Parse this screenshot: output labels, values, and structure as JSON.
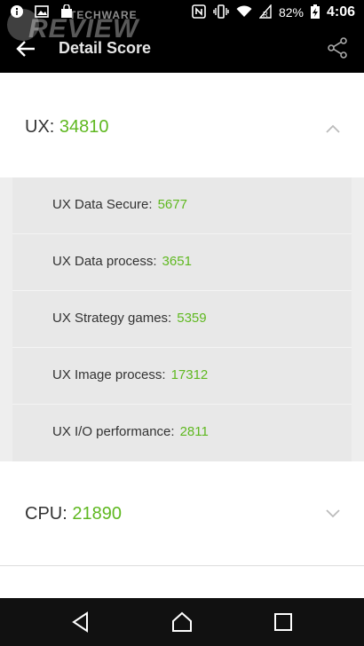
{
  "status_bar": {
    "battery": "82%",
    "time": "4:06"
  },
  "watermark": {
    "small": "TECHWARE",
    "big": "REVIEW"
  },
  "app_bar": {
    "title": "Detail Score"
  },
  "ux": {
    "label": "UX:",
    "score": "34810",
    "items": [
      {
        "label": "UX Data Secure:",
        "value": "5677"
      },
      {
        "label": "UX Data process:",
        "value": "3651"
      },
      {
        "label": "UX Strategy games:",
        "value": "5359"
      },
      {
        "label": "UX Image process:",
        "value": "17312"
      },
      {
        "label": "UX I/O performance:",
        "value": "2811"
      }
    ]
  },
  "cpu": {
    "label": "CPU:",
    "score": "21890"
  },
  "colors": {
    "accent_green": "#5fb820",
    "bar_black": "#000000",
    "expanded_bg": "#e8e8e8"
  }
}
